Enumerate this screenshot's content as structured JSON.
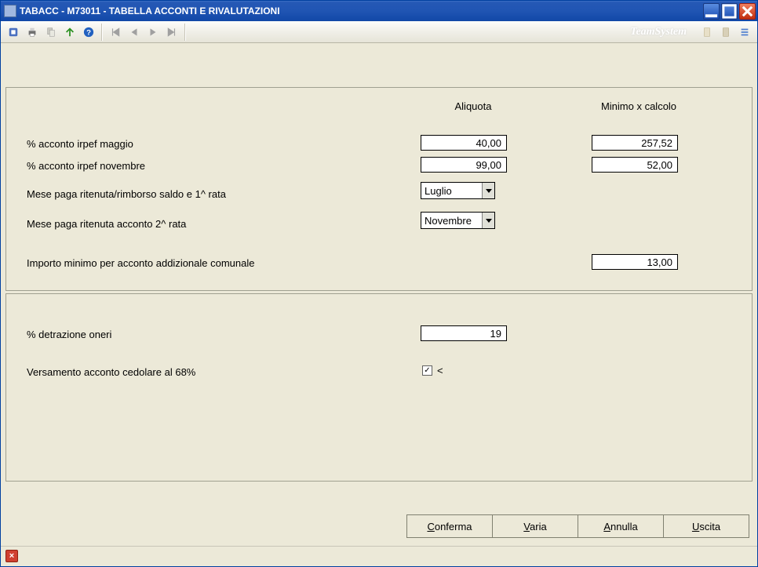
{
  "window": {
    "title": "TABACC  - M73011 -   TABELLA ACCONTI E RIVALUTAZIONI"
  },
  "brand": "TeamSystem",
  "headers": {
    "aliquota": "Aliquota",
    "minimo": "Minimo x calcolo"
  },
  "panel1": {
    "row1_label": "% acconto irpef maggio",
    "row1_aliq": "40,00",
    "row1_min": "257,52",
    "row2_label": "% acconto irpef novembre",
    "row2_aliq": "99,00",
    "row2_min": "52,00",
    "row3_label": "Mese paga ritenuta/rimborso saldo e 1^ rata",
    "row3_sel": "Luglio",
    "row4_label": "Mese paga ritenuta acconto  2^ rata",
    "row4_sel": "Novembre",
    "row5_label": "Importo minimo per acconto addizionale comunale",
    "row5_val": "13,00"
  },
  "panel2": {
    "row1_label": "% detrazione oneri",
    "row1_val": "19",
    "row2_label": "Versamento acconto cedolare al 68%",
    "row2_chk_extra": "<"
  },
  "buttons": {
    "conferma": "Conferma",
    "varia": "Varia",
    "annulla": "Annulla",
    "uscita": "Uscita"
  }
}
